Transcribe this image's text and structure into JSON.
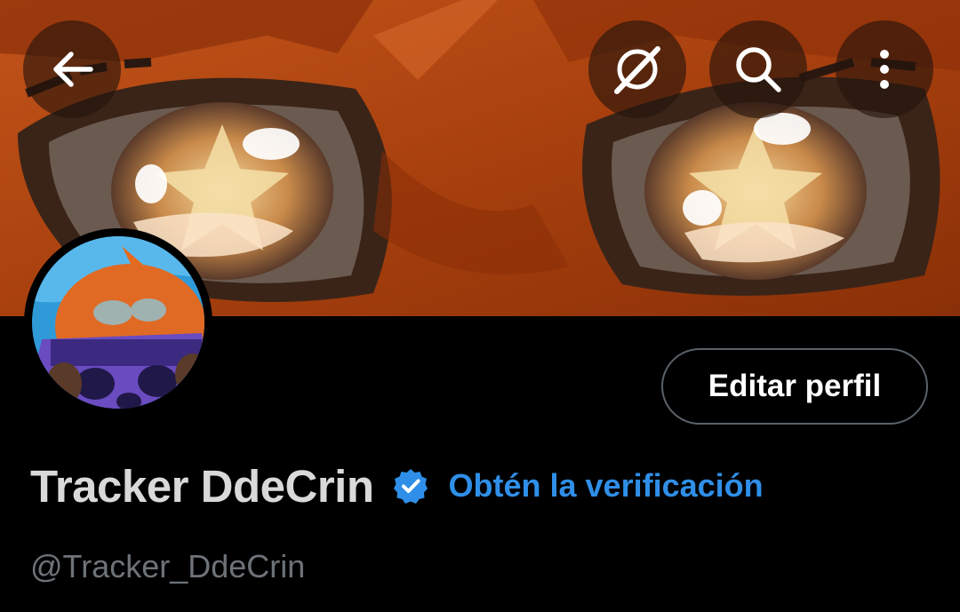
{
  "header": {
    "back_icon": "arrow-left-icon",
    "actions": [
      "grok-icon",
      "search-icon",
      "more-vertical-icon"
    ]
  },
  "banner": {
    "description_colors": [
      "#b5440e",
      "#8a2e08",
      "#3a2418"
    ]
  },
  "profile": {
    "display_name": "Tracker DdeCrin",
    "handle": "@Tracker_DdeCrin",
    "verified_icon": "verified-badge-icon",
    "verification_cta": "Obtén la verificación",
    "edit_button_label": "Editar perfil"
  },
  "colors": {
    "background": "#000000",
    "accent_blue": "#2f8fe8",
    "name_text": "#d9d9d9",
    "handle_text": "#6e7378",
    "button_border": "#5a6168"
  }
}
